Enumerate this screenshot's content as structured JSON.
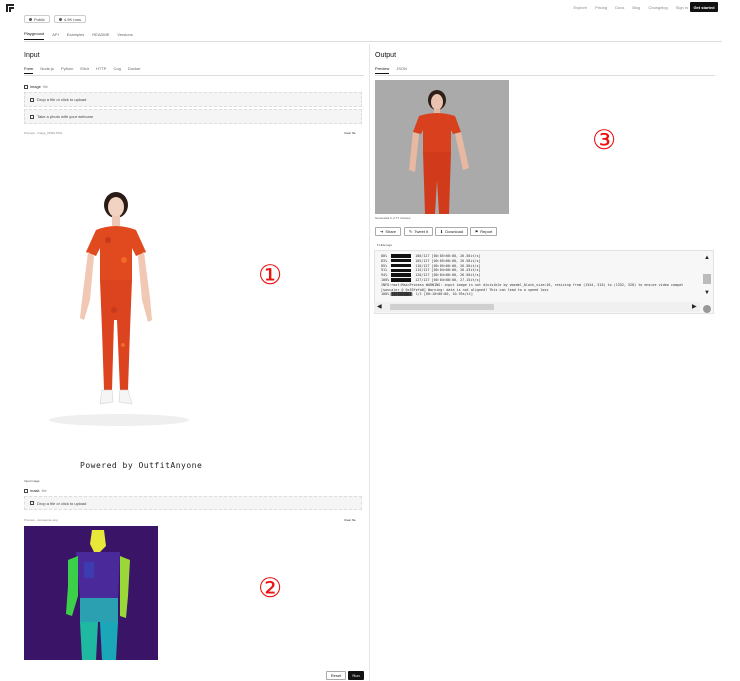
{
  "topnav": {
    "items": [
      "Explore",
      "Pricing",
      "Docs",
      "Blog",
      "Changelog",
      "Sign in"
    ],
    "cta": "Get started"
  },
  "badges": {
    "visibility": "Public",
    "runs": "4.9K runs"
  },
  "tabs": [
    "Playground",
    "API",
    "Examples",
    "README",
    "Versions"
  ],
  "input": {
    "title": "Input",
    "subtabs": [
      "Form",
      "Node.js",
      "Python",
      "Elixir",
      "HTTP",
      "Cog",
      "Docker"
    ],
    "image_field": {
      "label": "image",
      "type": "file",
      "dropzone": "Drop a file or click to upload",
      "webcam": "Take a photo with your webcam",
      "preview_label": "Preview - image_0PM2.PNG",
      "clear": "Clear file"
    },
    "watermark": "Powered by OutfitAnyone",
    "mask_section_label": "Input image",
    "mask_field": {
      "label": "mask",
      "type": "file",
      "dropzone": "Drop a file or click to upload",
      "preview_label": "Preview - densepose.png",
      "clear": "Clear file"
    },
    "reset": "Reset",
    "run": "Run"
  },
  "output": {
    "title": "Output",
    "subtabs": [
      "Preview",
      "JSON"
    ],
    "generated": "Generated in 2.77 minutes",
    "actions": [
      "Share",
      "Tweet it",
      "Download",
      "Report"
    ],
    "logs_toggle": "Hide logs",
    "log_lines": [
      {
        "pct": "80%",
        "frac": "100/127",
        "time": "[00:05<00:00, 26.58it/s]"
      },
      {
        "pct": "83%",
        "frac": "105/127",
        "time": "[00:05<00:00, 26.58it/s]"
      },
      {
        "pct": "85%",
        "frac": "110/127",
        "time": "[00:05<00:00, 26.58it/s]"
      },
      {
        "pct": "91%",
        "frac": "115/127",
        "time": "[00:04<00:00, 26.43it/s]"
      },
      {
        "pct": "94%",
        "frac": "120/127",
        "time": "[00:04<00:00, 26.58it/s]"
      },
      {
        "pct": "100%",
        "frac": "127/127",
        "time": "[00:04<00:00, 27.15it/s]"
      }
    ],
    "log_text": [
      "INFO:root:MainProcess WARNING: input image is not divisible by vmodel_block_size=16, resizing from (1344, 516) to (1352, 528) to ensure video compat",
      "[swscaler @ 0x55fefa0] Warning: data is not aligned! This can lead to a speed loss",
      "100%|██████████| 1/1 [00:10<00:00, 10.95s/it]"
    ]
  },
  "annotations": [
    "①",
    "②",
    "③"
  ]
}
